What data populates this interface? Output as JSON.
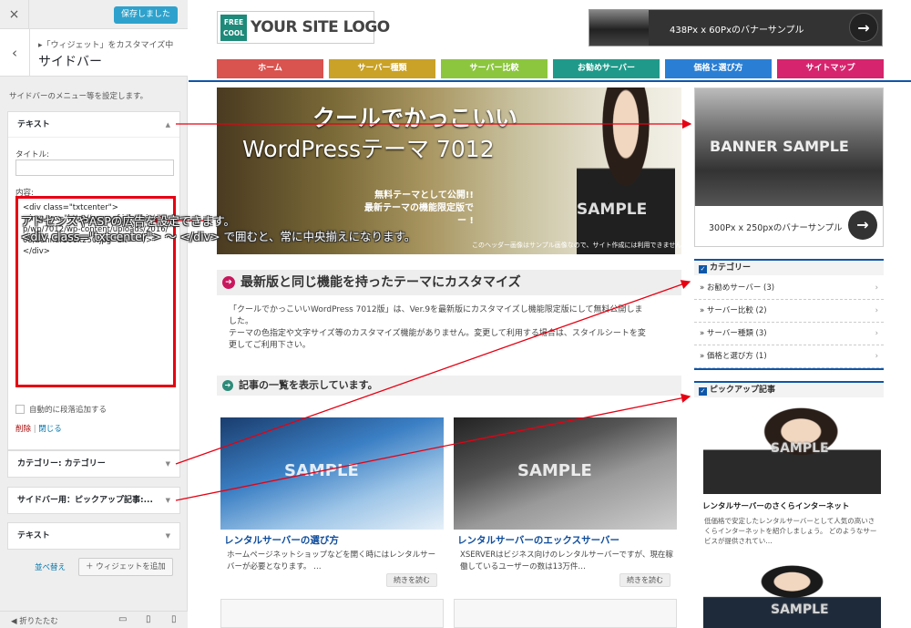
{
  "customizer": {
    "close_icon": "×",
    "save_label": "保存しました",
    "breadcrumb": "▸「ウィジェット」をカスタマイズ中",
    "section_title": "サイドバー",
    "description": "サイドバーのメニュー等を設定します。",
    "widgets": [
      {
        "title": "テキスト",
        "expanded": true
      },
      {
        "title": "カテゴリー: カテゴリー",
        "expanded": false
      },
      {
        "title": "サイドバー用：ピックアップ記事:...",
        "expanded": false
      },
      {
        "title": "テキスト",
        "expanded": false
      }
    ],
    "text_widget": {
      "title_label": "タイトル:",
      "title_value": "",
      "content_label": "内容:",
      "content_value": "<div class=\"txtcenter\">\n<img src=\"http://www.af-joho.biz/smp/wp/7012/wp-content/uploads/2016/08/banner300x250.jpg\" alt=\"\" />\n</div>",
      "auto_paragraph_label": "自動的に段落追加する",
      "delete_label": "削除",
      "separator": " | ",
      "close_label": "閉じる"
    },
    "reorder_label": "並べ替え",
    "add_widget_label": "ウィジェットを追加",
    "collapse_label": "折りたたむ"
  },
  "site": {
    "logo_badge_line1": "FREE",
    "logo_badge_line2": "COOL",
    "logo_text": "YOUR SITE LOGO",
    "top_banner_text": "438Px x 60Pxのバナーサンプル",
    "nav": [
      {
        "label": "ホーム",
        "color": "#d9534f"
      },
      {
        "label": "サーバー種類",
        "color": "#c9a227"
      },
      {
        "label": "サーバー比較",
        "color": "#8cc63f"
      },
      {
        "label": "お勧めサーバー",
        "color": "#1f9a8a"
      },
      {
        "label": "価格と選び方",
        "color": "#2a7fd4"
      },
      {
        "label": "サイトマップ",
        "color": "#d6246e"
      }
    ],
    "hero": {
      "line1": "クールでかっこいい",
      "line2": "WordPressテーマ 7012",
      "line3": "無料テーマとして公開!!",
      "line4": "最新テーマの機能限定版で",
      "line5": "ー !",
      "sample": "SAMPLE",
      "note": "このヘッダー画像はサンプル画像なので、サイト作成には利用できません。"
    },
    "callout_line1": "アドセンスやASPの広告を設定できます。",
    "callout_line2": "<div class=\"txtcenter\"> ～ </div> で囲むと、常に中央揃えになります。",
    "section1_title": "最新版と同じ機能を持ったテーマにカスタマイズ",
    "intro_line1": "「クールでかっこいいWordPress 7012版」は、Ver.9を最新版にカスタマイズし機能限定版にして無料公開しました。",
    "intro_line2": "テーマの色指定や文字サイズ等のカスタマイズ機能がありません。変更して利用する場合は、スタイルシートを変更してご利用下さい。",
    "section2_title": "記事の一覧を表示しています。",
    "posts": [
      {
        "title": "レンタルサーバーの選び方",
        "excerpt": "ホームページネットショップなどを開く時にはレンタルサーバーが必要となります。 …",
        "more": "続きを読む",
        "sample": "SAMPLE"
      },
      {
        "title": "レンタルサーバーのエックスサーバー",
        "excerpt": "XSERVERはビジネス向けのレンタルサーバーですが、現在稼働しているユーザーの数は13万件…",
        "more": "続きを読む",
        "sample": "SAMPLE"
      }
    ],
    "side_banner_text": "BANNER SAMPLE",
    "side_banner_caption": "300Px x 250pxのバナーサンプル",
    "category_head": "カテゴリー",
    "categories": [
      "» お勧めサーバー (3)",
      "» サーバー比較 (2)",
      "» サーバー種類 (3)",
      "» 価格と選び方 (1)"
    ],
    "pickup_head": "ピックアップ記事",
    "pickup_title": "レンタルサーバーのさくらインターネット",
    "pickup_desc": "低価格で安定したレンタルサーバーとして人気の高いさくらインターネットを紹介しましょう。 どのようなサービスが提供されてい…",
    "pickup_sample": "SAMPLE",
    "accent_color": "#0e56a8",
    "annotation_color": "#e60012"
  }
}
